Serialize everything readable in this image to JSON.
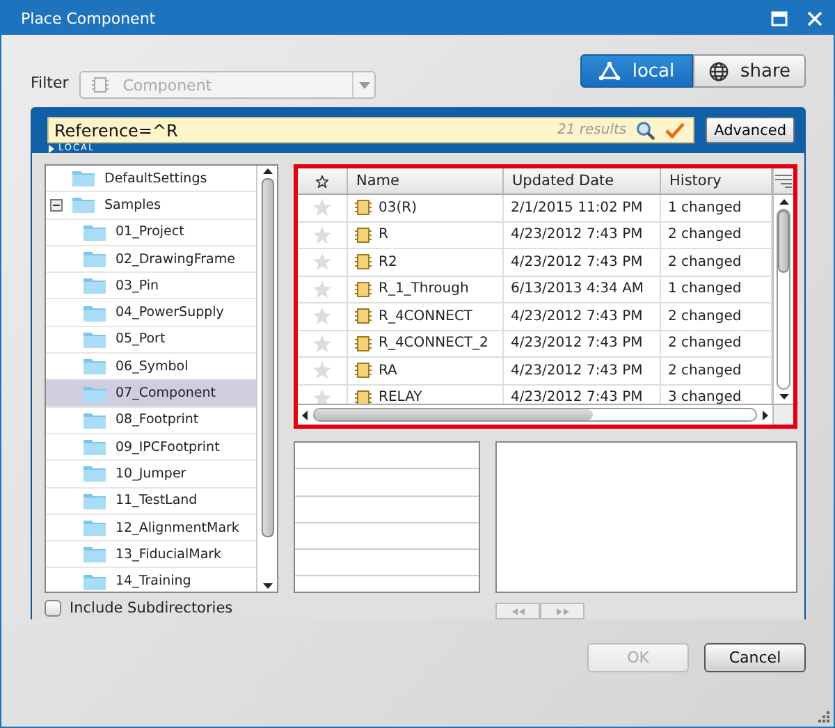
{
  "window": {
    "title": "Place Component"
  },
  "filter": {
    "label": "Filter",
    "value": "Component",
    "disabled": true
  },
  "scope_toggle": [
    {
      "label": "local",
      "kind": "local",
      "selected": true
    },
    {
      "label": "share",
      "kind": "share",
      "selected": false
    }
  ],
  "search": {
    "value": "Reference=^R",
    "result_count": "21 results",
    "scope_label": "LOCAL"
  },
  "advanced_button": "Advanced",
  "tree": [
    {
      "label": "DefaultSettings",
      "selected": false
    },
    {
      "label": "Samples",
      "selected": false,
      "expanded": true,
      "children": [
        {
          "label": "01_Project",
          "selected": false
        },
        {
          "label": "02_DrawingFrame",
          "selected": false
        },
        {
          "label": "03_Pin",
          "selected": false
        },
        {
          "label": "04_PowerSupply",
          "selected": false
        },
        {
          "label": "05_Port",
          "selected": false
        },
        {
          "label": "06_Symbol",
          "selected": false
        },
        {
          "label": "07_Component",
          "selected": true
        },
        {
          "label": "08_Footprint",
          "selected": false
        },
        {
          "label": "09_IPCFootprint",
          "selected": false
        },
        {
          "label": "10_Jumper",
          "selected": false
        },
        {
          "label": "11_TestLand",
          "selected": false
        },
        {
          "label": "12_AlignmentMark",
          "selected": false
        },
        {
          "label": "13_FiducialMark",
          "selected": false
        },
        {
          "label": "14_Training",
          "selected": false
        }
      ]
    }
  ],
  "include_subdirectories": {
    "label": "Include Subdirectories",
    "checked": false
  },
  "table": {
    "columns": [
      "Name",
      "Updated Date",
      "History"
    ],
    "rows": [
      {
        "starred": false,
        "name": "03(R)",
        "date": "2/1/2015 11:02 PM",
        "history": "1 changed"
      },
      {
        "starred": false,
        "name": "R",
        "date": "4/23/2012 7:43 PM",
        "history": "2 changed"
      },
      {
        "starred": false,
        "name": "R2",
        "date": "4/23/2012 7:43 PM",
        "history": "2 changed"
      },
      {
        "starred": false,
        "name": "R_1_Through",
        "date": "6/13/2013 4:34 AM",
        "history": "1 changed"
      },
      {
        "starred": false,
        "name": "R_4CONNECT",
        "date": "4/23/2012 7:43 PM",
        "history": "2 changed"
      },
      {
        "starred": false,
        "name": "R_4CONNECT_2",
        "date": "4/23/2012 7:43 PM",
        "history": "2 changed"
      },
      {
        "starred": false,
        "name": "RA",
        "date": "4/23/2012 7:43 PM",
        "history": "2 changed"
      },
      {
        "starred": false,
        "name": "RELAY",
        "date": "4/23/2012 7:43 PM",
        "history": "3 changed"
      }
    ]
  },
  "buttons": [
    {
      "label": "OK",
      "disabled": true
    },
    {
      "label": "Cancel",
      "disabled": false
    }
  ]
}
